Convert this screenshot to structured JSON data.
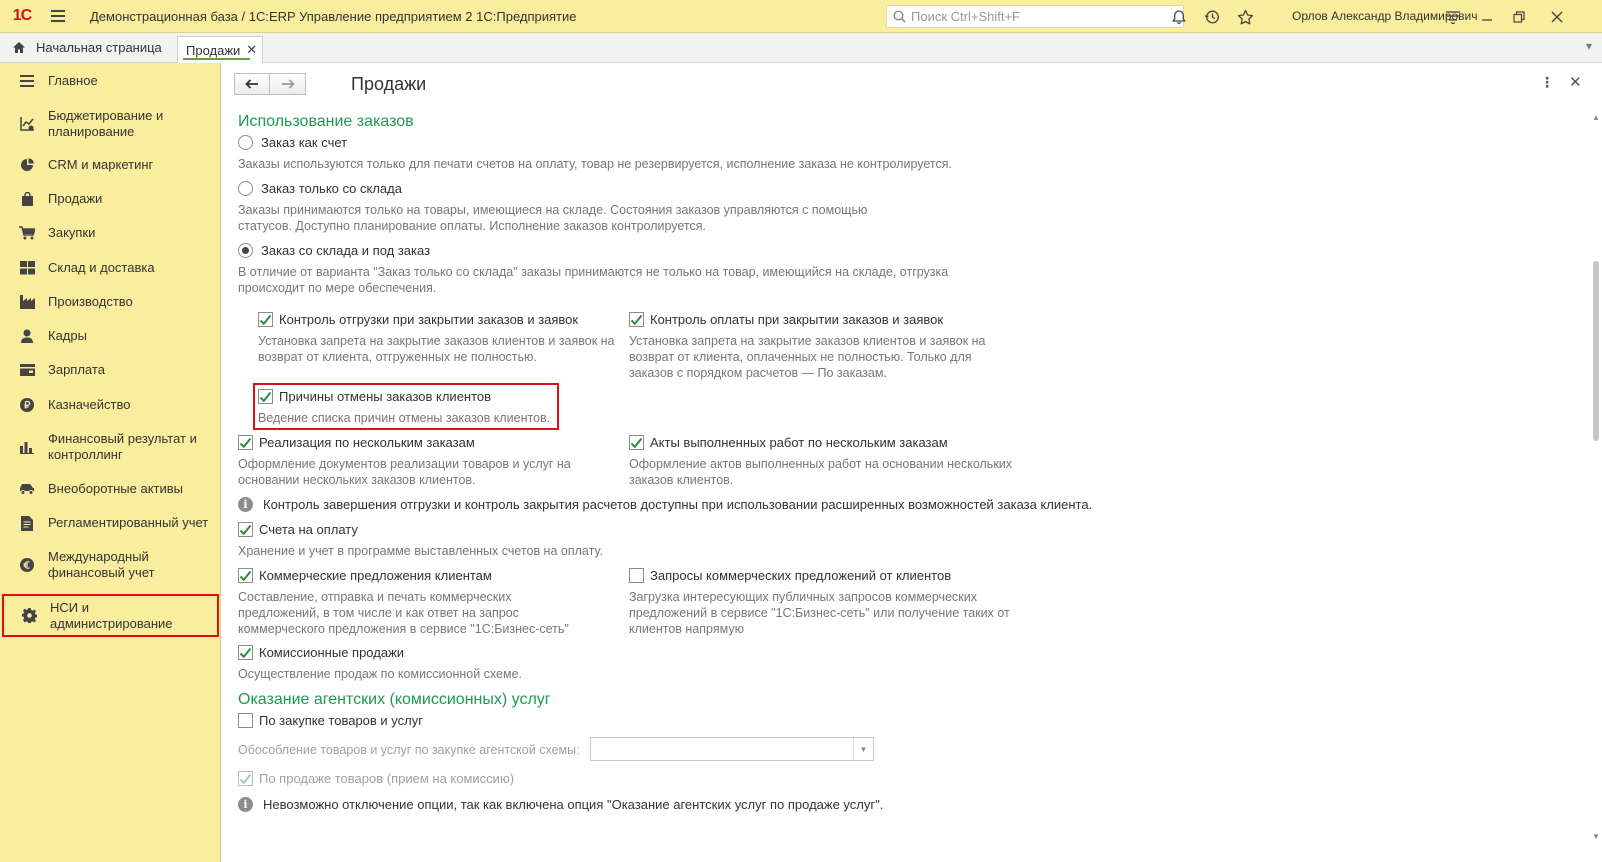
{
  "titlebar": {
    "logo": "1С",
    "title": "Демонстрационная база / 1С:ERP Управление предприятием 2 1С:Предприятие",
    "search_placeholder": "Поиск Ctrl+Shift+F",
    "user": "Орлов Александр Владимирович"
  },
  "tabs": {
    "home": "Начальная страница",
    "active": "Продажи",
    "close": "✕"
  },
  "sidebar": {
    "items": [
      {
        "label": "Главное",
        "icon": "menu-icon"
      },
      {
        "label": "Бюджетирование и планирование",
        "icon": "budget-icon"
      },
      {
        "label": "CRM и маркетинг",
        "icon": "pie-chart-icon"
      },
      {
        "label": "Продажи",
        "icon": "bag-icon"
      },
      {
        "label": "Закупки",
        "icon": "cart-icon"
      },
      {
        "label": "Склад и доставка",
        "icon": "warehouse-icon"
      },
      {
        "label": "Производство",
        "icon": "factory-icon"
      },
      {
        "label": "Кадры",
        "icon": "person-icon"
      },
      {
        "label": "Зарплата",
        "icon": "wallet-icon"
      },
      {
        "label": "Казначейство",
        "icon": "coin-icon"
      },
      {
        "label": "Финансовый результат и контроллинг",
        "icon": "bar-chart-icon"
      },
      {
        "label": "Внеоборотные активы",
        "icon": "car-icon"
      },
      {
        "label": "Регламентированный учет",
        "icon": "document-icon"
      },
      {
        "label": "Международный финансовый учет",
        "icon": "euro-icon"
      },
      {
        "label": "НСИ и администрирование",
        "icon": "gear-icon"
      }
    ]
  },
  "page": {
    "title": "Продажи",
    "sections": {
      "orders": "Использование заказов",
      "agent": "Оказание агентских (комиссионных) услуг"
    },
    "radios": [
      {
        "label": "Заказ как счет",
        "selected": false,
        "desc": "Заказы используются только для печати счетов на оплату, товар не резервируется, исполнение заказа не контролируется."
      },
      {
        "label": "Заказ только со склада",
        "selected": false,
        "desc1": "Заказы принимаются только на товары, имеющиеся на складе. Состояния заказов управляются с помощью",
        "desc2": "статусов. Доступно планирование оплаты. Исполнение заказов контролируется."
      },
      {
        "label": "Заказ со склада и под заказ",
        "selected": true,
        "desc1": "В отличие от варианта \"Заказ только со склада\" заказы принимаются не только на товар, имеющийся на складе, отгрузка",
        "desc2": "происходит по мере обеспечения."
      }
    ],
    "checks": {
      "shipment_control": {
        "label": "Контроль отгрузки при закрытии заказов и заявок",
        "checked": true,
        "desc1": "Установка запрета на закрытие заказов клиентов и заявок на",
        "desc2": "возврат от клиента, отгруженных не полностью."
      },
      "payment_control": {
        "label": "Контроль оплаты при закрытии заказов и заявок",
        "checked": true,
        "desc1": "Установка запрета на закрытие заказов клиентов и заявок на",
        "desc2": "возврат от клиента, оплаченных не полностью. Только для",
        "desc3": "заказов с порядком расчетов — По заказам."
      },
      "cancel_reasons": {
        "label": "Причины отмены заказов клиентов",
        "checked": true,
        "desc": "Ведение списка причин отмены заказов клиентов."
      },
      "multi_orders": {
        "label": "Реализация по нескольким заказам",
        "checked": true,
        "desc1": "Оформление документов реализации товаров и услуг на",
        "desc2": "основании нескольких заказов клиентов."
      },
      "acts": {
        "label": "Акты выполненных работ по нескольким заказам",
        "checked": true,
        "desc1": "Оформление актов выполненных работ на основании нескольких",
        "desc2": "заказов клиентов."
      },
      "invoices": {
        "label": "Счета на оплату",
        "checked": true,
        "desc": "Хранение и учет в программе выставленных счетов на оплату."
      },
      "proposals": {
        "label": "Коммерческие предложения клиентам",
        "checked": true,
        "desc1": "Составление, отправка и печать коммерческих",
        "desc2": "предложений, в том числе и как ответ на запрос",
        "desc3": "коммерческого предложения в сервисе \"1С:Бизнес-сеть\""
      },
      "proposal_requests": {
        "label": "Запросы коммерческих предложений от клиентов",
        "checked": false,
        "desc1": "Загрузка интересующих публичных запросов коммерческих",
        "desc2": "предложений в сервисе \"1С:Бизнес-сеть\" или получение таких от",
        "desc3": "клиентов напрямую"
      },
      "commission": {
        "label": "Комиссионные продажи",
        "checked": true,
        "desc": "Осуществление продаж по комиссионной схеме."
      },
      "purchase_agent": {
        "label": "По закупке товаров и услуг",
        "checked": false
      },
      "sale_agent": {
        "label": "По продаже товаров (прием на комиссию)",
        "checked": true
      }
    },
    "info1": "Контроль завершения отгрузки и контроль закрытия расчетов доступны при использовании расширенных возможностей заказа клиента.",
    "separation_label": "Обособление товаров и услуг по закупке агентской схемы:",
    "separation_value": "",
    "info2": "Невозможно отключение опции, так как включена опция \"Оказание агентских услуг по продаже услуг\"."
  },
  "colors": {
    "accent_yellow": "#fbed9e",
    "section_green": "#1d9b52",
    "highlight_red": "#d9101e",
    "check_green": "#2e8b3e"
  }
}
